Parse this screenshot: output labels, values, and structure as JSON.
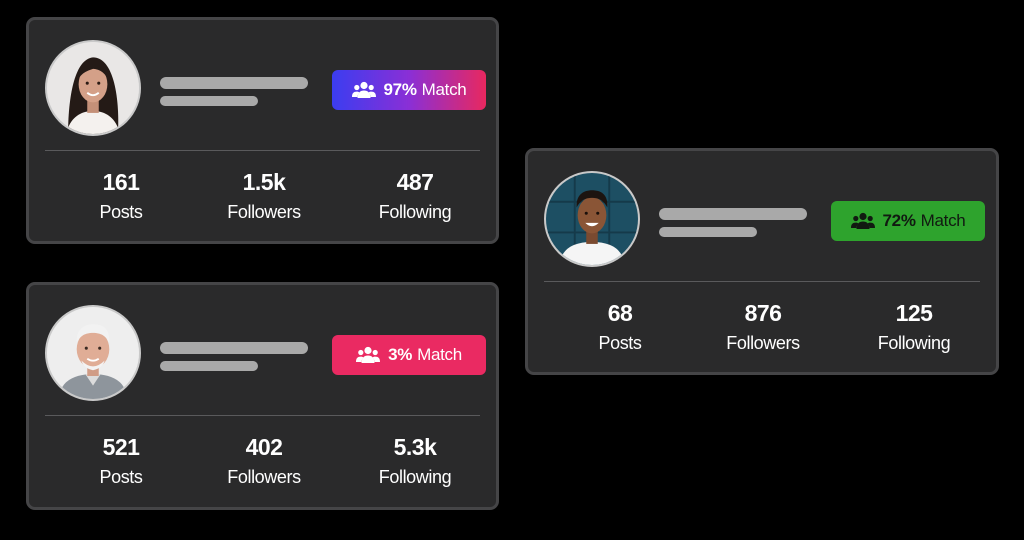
{
  "profiles": [
    {
      "match": {
        "percent": "97%",
        "label": "Match",
        "colors": [
          "#3b3df0",
          "#e8285f"
        ]
      },
      "stats": {
        "posts": {
          "value": "161",
          "label": "Posts"
        },
        "followers": {
          "value": "1.5k",
          "label": "Followers"
        },
        "following": {
          "value": "487",
          "label": "Following"
        }
      },
      "avatar": "young-woman-portrait"
    },
    {
      "match": {
        "percent": "3%",
        "label": "Match",
        "colors": [
          "#ea2a62"
        ]
      },
      "stats": {
        "posts": {
          "value": "521",
          "label": "Posts"
        },
        "followers": {
          "value": "402",
          "label": "Followers"
        },
        "following": {
          "value": "5.3k",
          "label": "Following"
        }
      },
      "avatar": "older-man-portrait"
    },
    {
      "match": {
        "percent": "72%",
        "label": "Match",
        "colors": [
          "#2ea32d"
        ]
      },
      "stats": {
        "posts": {
          "value": "68",
          "label": "Posts"
        },
        "followers": {
          "value": "876",
          "label": "Followers"
        },
        "following": {
          "value": "125",
          "label": "Following"
        }
      },
      "avatar": "young-man-portrait"
    }
  ],
  "icons": {
    "match": "group-users-icon"
  },
  "theme": {
    "card_bg": "#2a2a2b",
    "card_border": "#454547",
    "placeholder": "#a9a9a9"
  }
}
